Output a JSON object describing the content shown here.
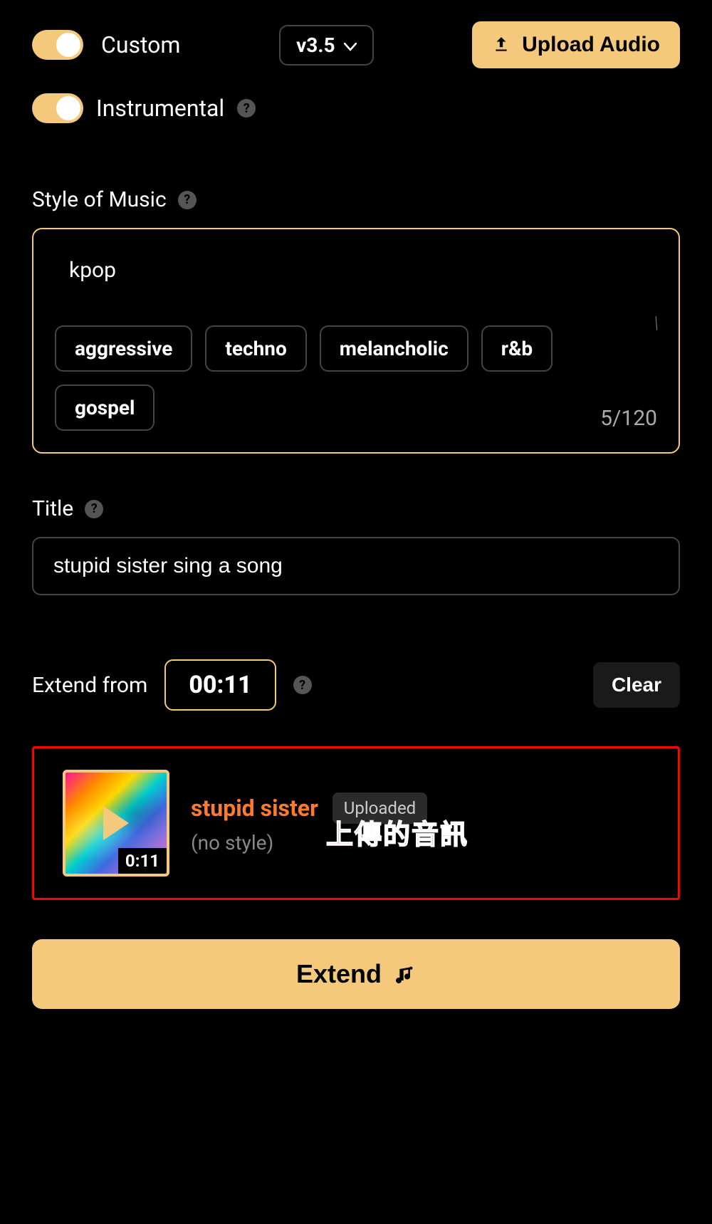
{
  "top": {
    "custom_label": "Custom",
    "version": "v3.5",
    "upload_label": "Upload Audio",
    "instrumental_label": "Instrumental"
  },
  "style": {
    "section_label": "Style of Music",
    "value": "kpop",
    "char_count": "5/120",
    "chips": [
      "aggressive",
      "techno",
      "melancholic",
      "r&b",
      "gospel"
    ]
  },
  "title": {
    "section_label": "Title",
    "value": "stupid sister sing a song"
  },
  "extend": {
    "from_label": "Extend from",
    "time": "00:11",
    "clear_label": "Clear"
  },
  "track": {
    "title": "stupid sister",
    "badge": "Uploaded",
    "subtitle": "(no style)",
    "duration": "0:11",
    "annotation": "上傳的音訊"
  },
  "action": {
    "extend_label": "Extend"
  }
}
